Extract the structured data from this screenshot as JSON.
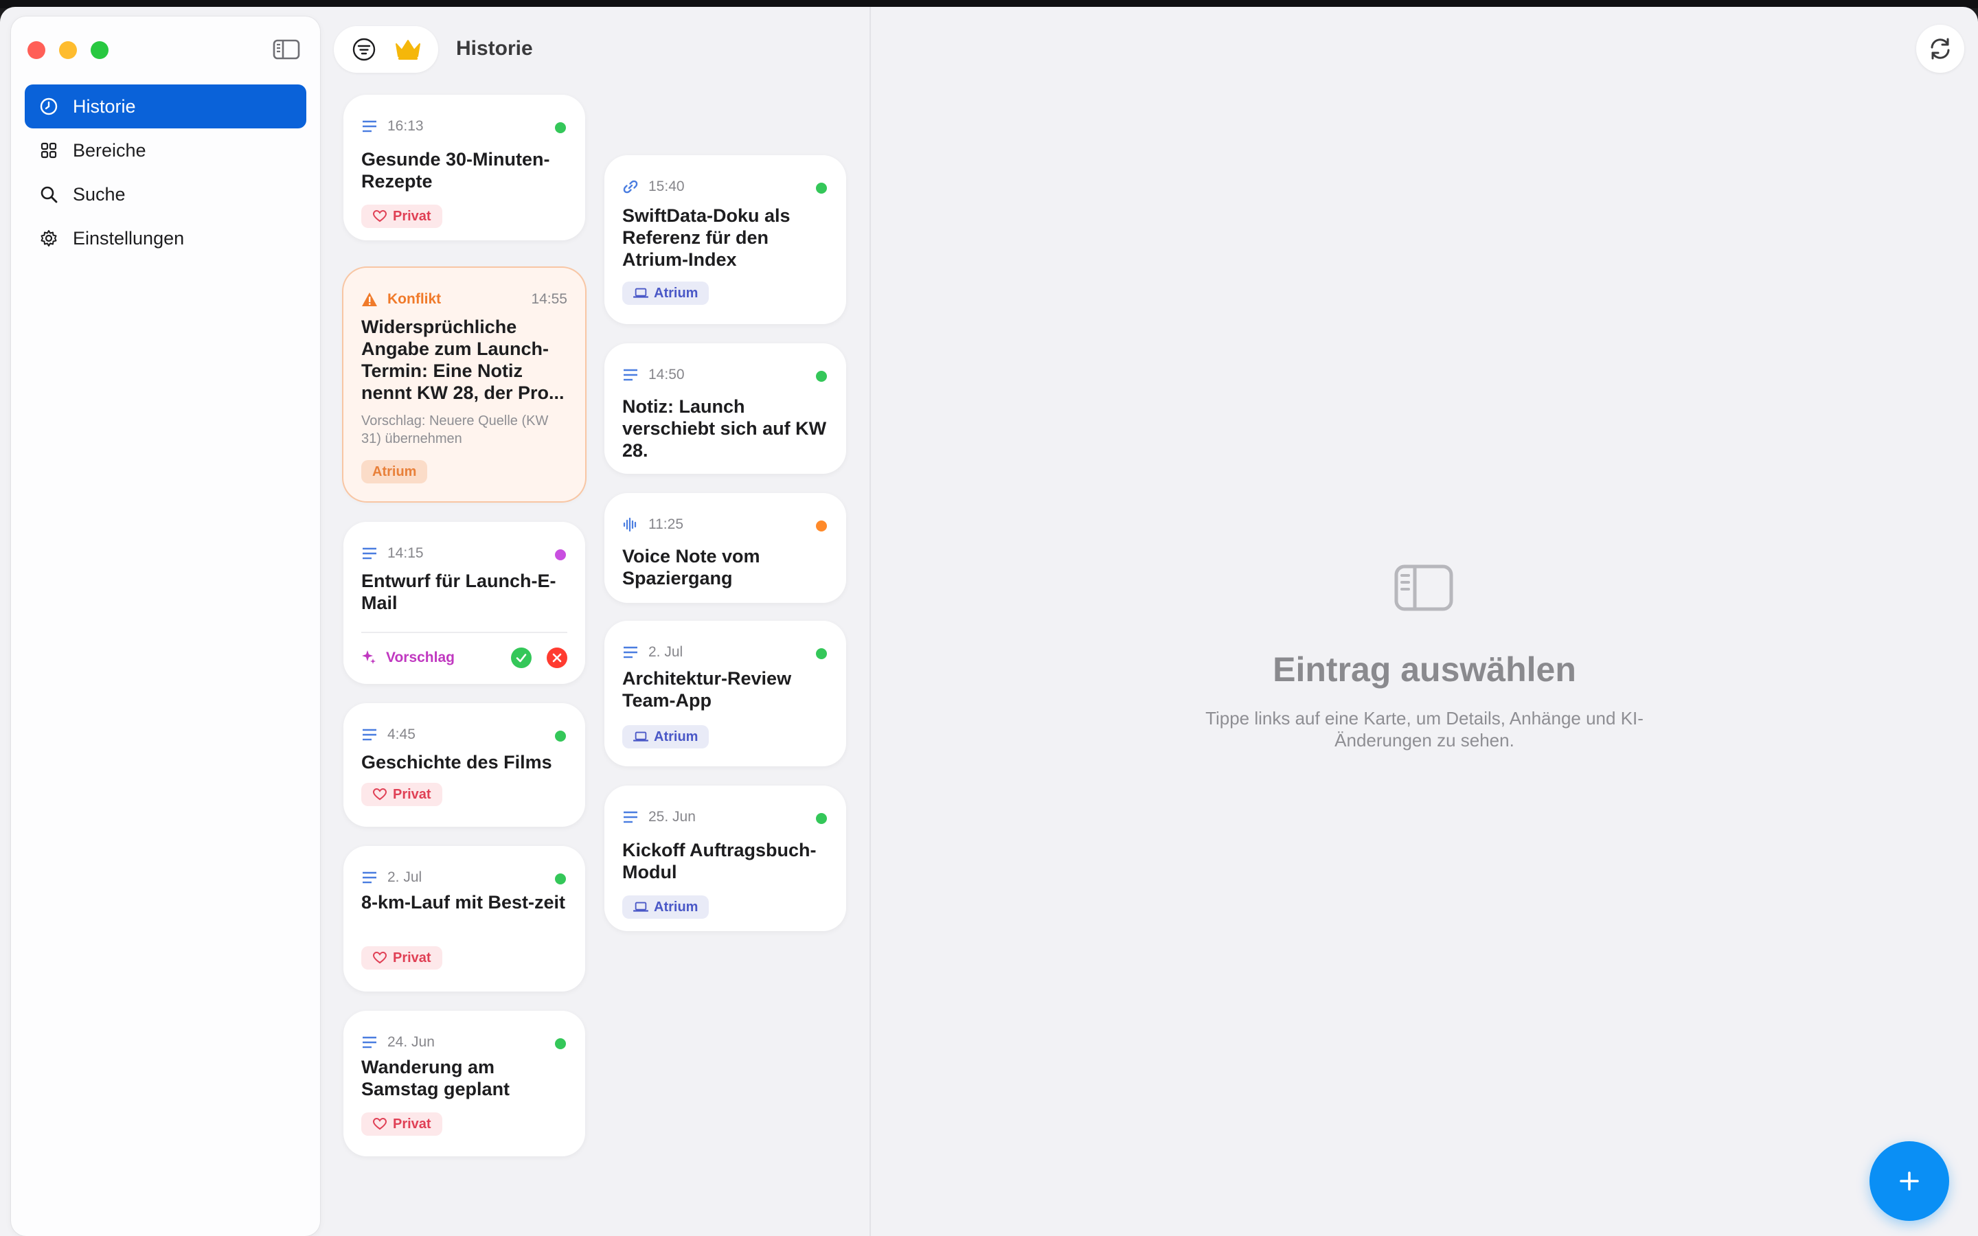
{
  "window": {
    "title": "Historie"
  },
  "sidebar": {
    "items": [
      {
        "label": "Historie",
        "icon": "clock-icon",
        "active": true
      },
      {
        "label": "Bereiche",
        "icon": "grid-icon",
        "active": false
      },
      {
        "label": "Suche",
        "icon": "search-icon",
        "active": false
      },
      {
        "label": "Einstellungen",
        "icon": "gear-icon",
        "active": false
      }
    ]
  },
  "toolbar": {
    "title": "Historie"
  },
  "cards": {
    "left": [
      {
        "time": "16:13",
        "title": "Gesunde 30-Minuten-Rezepte",
        "tag": "Privat",
        "status": "#34c759"
      },
      {
        "conflict_label": "Konflikt",
        "time": "14:55",
        "title": "Widersprüchliche Angabe zum Launch-Termin: Eine Notiz nennt KW 28, der Pro...",
        "suggestion": "Vorschlag: Neuere Quelle (KW 31) übernehmen",
        "tag": "Atrium"
      },
      {
        "time": "14:15",
        "title": "Entwurf für Launch-E-Mail",
        "suggestion_label": "Vorschlag",
        "status": "#c94fe0"
      },
      {
        "time": "4:45",
        "title": "Geschichte des Films",
        "tag": "Privat",
        "status": "#34c759"
      },
      {
        "time": "2. Jul",
        "title": "8-km-Lauf mit Best-zeit",
        "tag": "Privat",
        "status": "#34c759"
      },
      {
        "time": "24. Jun",
        "title": "Wanderung am Samstag geplant",
        "tag": "Privat",
        "status": "#34c759"
      }
    ],
    "right": [
      {
        "time": "15:40",
        "title": "SwiftData-Doku als Referenz für den Atrium-Index",
        "tag": "Atrium",
        "status": "#34c759"
      },
      {
        "time": "14:50",
        "title": "Notiz: Launch verschiebt sich auf KW 28.",
        "status": "#34c759"
      },
      {
        "time": "11:25",
        "title": "Voice Note vom Spaziergang",
        "status": "#ff8a2a"
      },
      {
        "time": "2. Jul",
        "title": "Architektur-Review Team-App",
        "tag": "Atrium",
        "status": "#34c759"
      },
      {
        "time": "25. Jun",
        "title": "Kickoff Auftragsbuch-Modul",
        "tag": "Atrium",
        "status": "#34c759"
      }
    ]
  },
  "detail": {
    "empty_title": "Eintrag auswählen",
    "empty_text": "Tippe links auf eine Karte, um Details, Anhänge und KI-Änderungen zu sehen."
  },
  "colors": {
    "accent": "#0a62d9",
    "fab": "#0a8ff5",
    "privat": "#e04055",
    "atrium": "#4a58c7",
    "conflict": "#f07a2a"
  }
}
